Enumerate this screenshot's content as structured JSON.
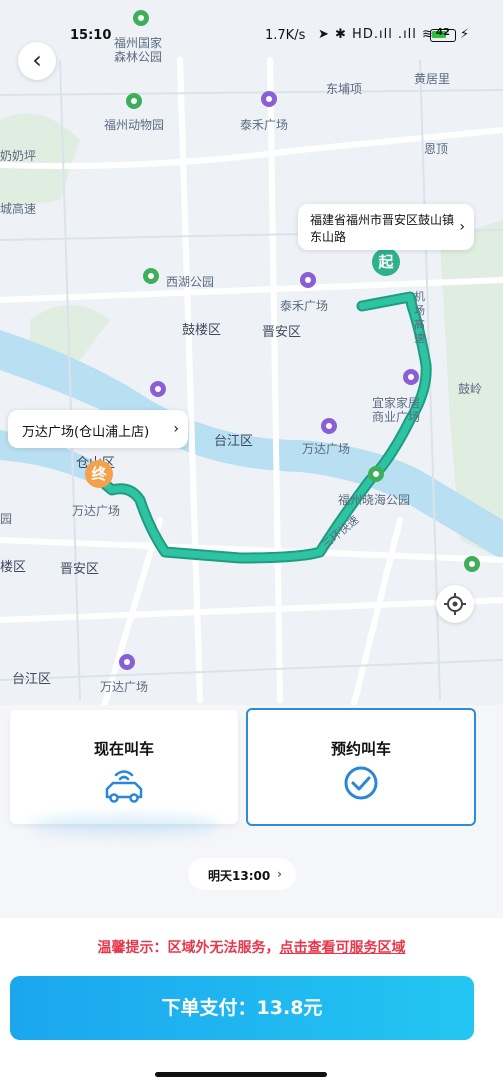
{
  "status_bar": {
    "time": "15:10",
    "network_speed": "1.7K/s",
    "icons_text": "➤ ✱ HD.ıll .ıll ≋",
    "battery": "42",
    "charge_icon": "⚡"
  },
  "map": {
    "labels": [
      {
        "text": "福州国家",
        "name": "poi-label-national-forest-1"
      },
      {
        "text": "森林公园",
        "name": "poi-label-national-forest-2"
      },
      {
        "text": "黄居里",
        "name": "place-label-huangjuli"
      },
      {
        "text": "东埔项",
        "name": "place-label-dongpuxiang"
      },
      {
        "text": "福州动物园",
        "name": "poi-label-zoo"
      },
      {
        "text": "泰禾广场",
        "name": "poi-label-taihe-1"
      },
      {
        "text": "恩顶",
        "name": "place-label-ending"
      },
      {
        "text": "奶奶坪",
        "name": "place-label-nainaiping"
      },
      {
        "text": "城高速",
        "name": "road-label-chenggaosu"
      },
      {
        "text": "西湖公园",
        "name": "poi-label-xihu-park"
      },
      {
        "text": "泰禾广场",
        "name": "poi-label-taihe-2"
      },
      {
        "text": "鼓楼区",
        "name": "district-label-gulou"
      },
      {
        "text": "晋安区",
        "name": "district-label-jinan-1"
      },
      {
        "text": "宜家家居",
        "name": "poi-label-ikea-1"
      },
      {
        "text": "商业广场",
        "name": "poi-label-ikea-2"
      },
      {
        "text": "鼓岭",
        "name": "place-label-guling"
      },
      {
        "text": "台江区",
        "name": "district-label-taijiang-1"
      },
      {
        "text": "万达广场",
        "name": "poi-label-wanda-1"
      },
      {
        "text": "仓山区",
        "name": "district-label-cangshan"
      },
      {
        "text": "万达广场",
        "name": "poi-label-wanda-2"
      },
      {
        "text": "福州晓海公园",
        "name": "poi-label-xiaohai-park"
      },
      {
        "text": "园",
        "name": "place-label-yuan"
      },
      {
        "text": "楼区",
        "name": "district-label-louqu"
      },
      {
        "text": "晋安区",
        "name": "district-label-jinan-2"
      },
      {
        "text": "台江区",
        "name": "district-label-taijiang-2"
      },
      {
        "text": "万达广场",
        "name": "poi-label-wanda-3"
      },
      {
        "text": "机场高速",
        "name": "road-label-airport-expressway"
      },
      {
        "text": "三环快速",
        "name": "road-label-third-ring"
      }
    ],
    "start_marker": "起",
    "end_marker": "终",
    "start_address": "福建省福州市晋安区鼓山镇东山路",
    "end_address": "万达广场(仓山浦上店)",
    "colors": {
      "route": "#22b899",
      "river": "#b9dff2",
      "road": "#ffffff"
    }
  },
  "options": {
    "now_label": "现在叫车",
    "booking_label": "预约叫车",
    "booking_selected": true
  },
  "schedule": {
    "time_label": "明天13:00"
  },
  "tip": {
    "prefix": "温馨提示：区域外无法服务，",
    "link": "点击查看可服务区域"
  },
  "pay": {
    "label": "下单支付：13.8元"
  }
}
